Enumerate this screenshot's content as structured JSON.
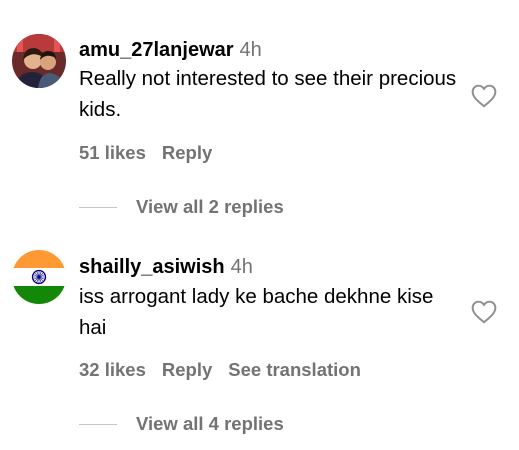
{
  "comments": [
    {
      "username": "amu_27lanjewar",
      "time": "4h",
      "text": "Really not interested to see their precious kids.",
      "likes": "51 likes",
      "reply": "Reply",
      "view_replies": "View all 2 replies",
      "avatar": "profile-photo"
    },
    {
      "username": "shailly_asiwish",
      "time": "4h",
      "text": "iss arrogant lady ke bache dekhne kise hai",
      "likes": "32 likes",
      "reply": "Reply",
      "translation": "See translation",
      "view_replies": "View all 4 replies",
      "avatar": "india-flag"
    }
  ],
  "colors": {
    "muted_text": "#737373",
    "divider": "#c7c7c7",
    "flag_saffron": "#ff9933",
    "flag_green": "#138808",
    "flag_chakra": "#000080"
  }
}
